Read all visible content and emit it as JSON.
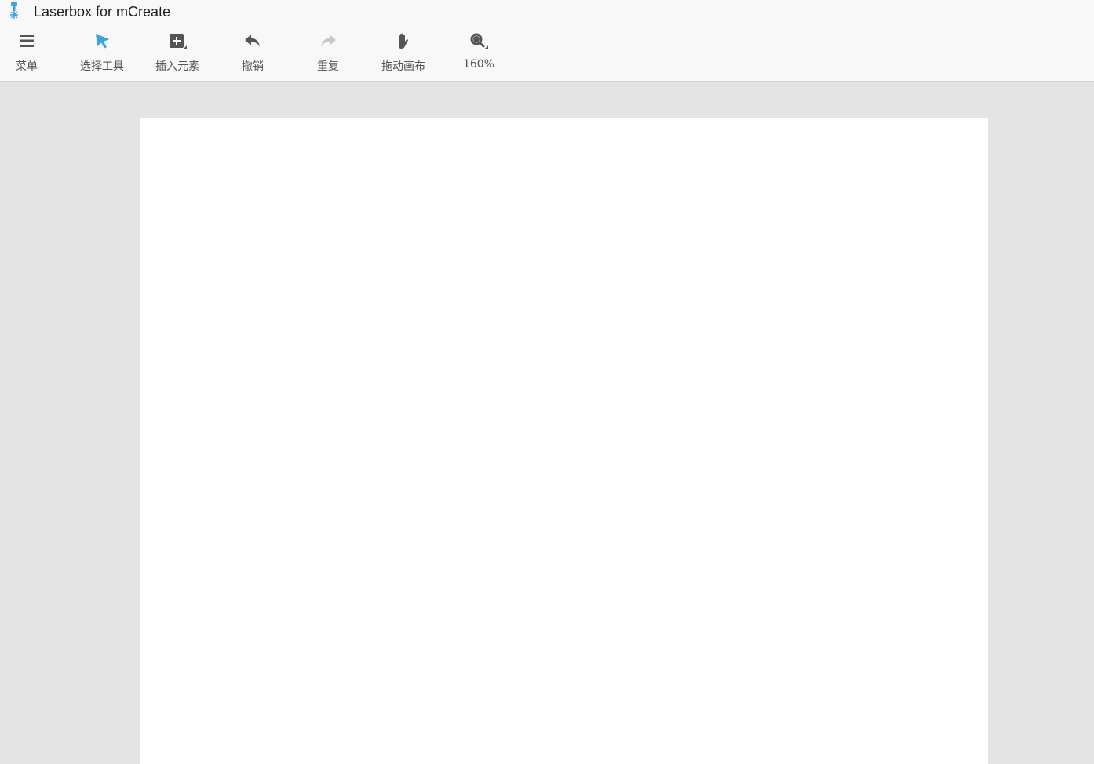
{
  "window": {
    "title": "Laserbox for mCreate"
  },
  "toolbar": {
    "menu_label": "菜单",
    "select_label": "选择工具",
    "insert_label": "插入元素",
    "undo_label": "撤销",
    "redo_label": "重复",
    "pan_label": "拖动画布",
    "zoom_label": "160%"
  },
  "icons": {
    "menu": "hamburger-icon",
    "select": "cursor-arrow-icon",
    "insert": "plus-square-icon",
    "undo": "undo-arrow-icon",
    "redo": "redo-arrow-icon",
    "pan": "hand-icon",
    "zoom": "magnifier-icon"
  },
  "colors": {
    "accent": "#3aa3e3",
    "icon": "#555555",
    "icon_disabled": "#c8c8c8",
    "canvas_bg": "#e3e3e3",
    "page_bg": "#ffffff",
    "toolbar_bg": "#f8f8f8"
  }
}
